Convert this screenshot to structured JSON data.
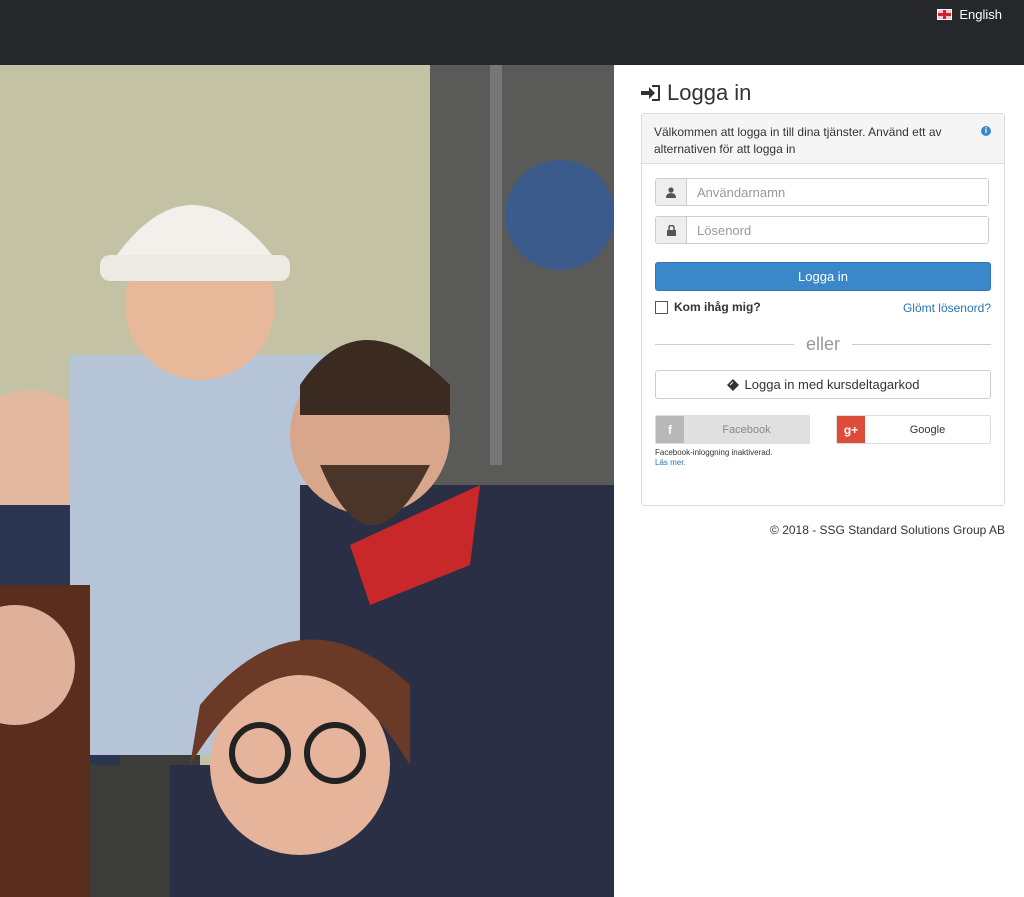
{
  "topbar": {
    "language": "English"
  },
  "photo": {
    "alt_icon": "group-photo"
  },
  "login": {
    "title": "Logga in",
    "intro": "Välkommen att logga in till dina tjänster. Använd ett av alternativen för att logga in",
    "username_placeholder": "Användarnamn",
    "password_placeholder": "Lösenord",
    "login_button": "Logga in",
    "remember_me": "Kom ihåg mig?",
    "forgot_password": "Glömt lösenord?",
    "or_divider": "eller",
    "course_code_button": "Logga in med kursdeltagarkod",
    "facebook_button": "Facebook",
    "google_button": "Google",
    "facebook_note": "Facebook-inloggning inaktiverad.",
    "read_more": "Läs mer."
  },
  "footer": {
    "copyright": "© 2018 - SSG Standard Solutions Group AB"
  },
  "colors": {
    "topbar": "#25272b",
    "primary": "#3a87c9",
    "google": "#dd4b39",
    "link": "#2a74b8"
  }
}
